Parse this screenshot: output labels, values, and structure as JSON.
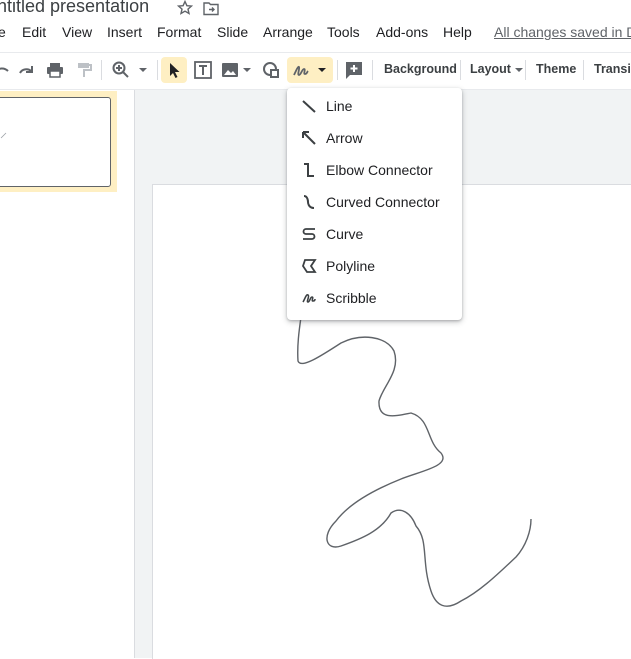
{
  "document": {
    "title": "ntitled presentation"
  },
  "menubar": {
    "items": [
      "e",
      "Edit",
      "View",
      "Insert",
      "Format",
      "Slide",
      "Arrange",
      "Tools",
      "Add-ons",
      "Help"
    ],
    "saved_status": "All changes saved in D"
  },
  "toolbar": {
    "background_label": "Background",
    "layout_label": "Layout",
    "theme_label": "Theme",
    "transition_label": "Transit",
    "icons": [
      "undo-icon",
      "redo-icon",
      "print-icon",
      "paint-format-icon",
      "zoom-icon",
      "select-icon",
      "text-box-icon",
      "image-icon",
      "shape-icon",
      "scribble-icon",
      "comment-icon"
    ],
    "active_color": "#feefc3"
  },
  "line_menu": {
    "items": [
      {
        "label": "Line",
        "icon": "line-icon"
      },
      {
        "label": "Arrow",
        "icon": "arrow-icon"
      },
      {
        "label": "Elbow Connector",
        "icon": "elbow-connector-icon"
      },
      {
        "label": "Curved Connector",
        "icon": "curved-connector-icon"
      },
      {
        "label": "Curve",
        "icon": "curve-icon"
      },
      {
        "label": "Polyline",
        "icon": "polyline-icon"
      },
      {
        "label": "Scribble",
        "icon": "scribble-icon"
      }
    ]
  },
  "colors": {
    "highlight": "#feefc3",
    "canvas_bg": "#f1f3f4",
    "text": "#3c4043"
  }
}
